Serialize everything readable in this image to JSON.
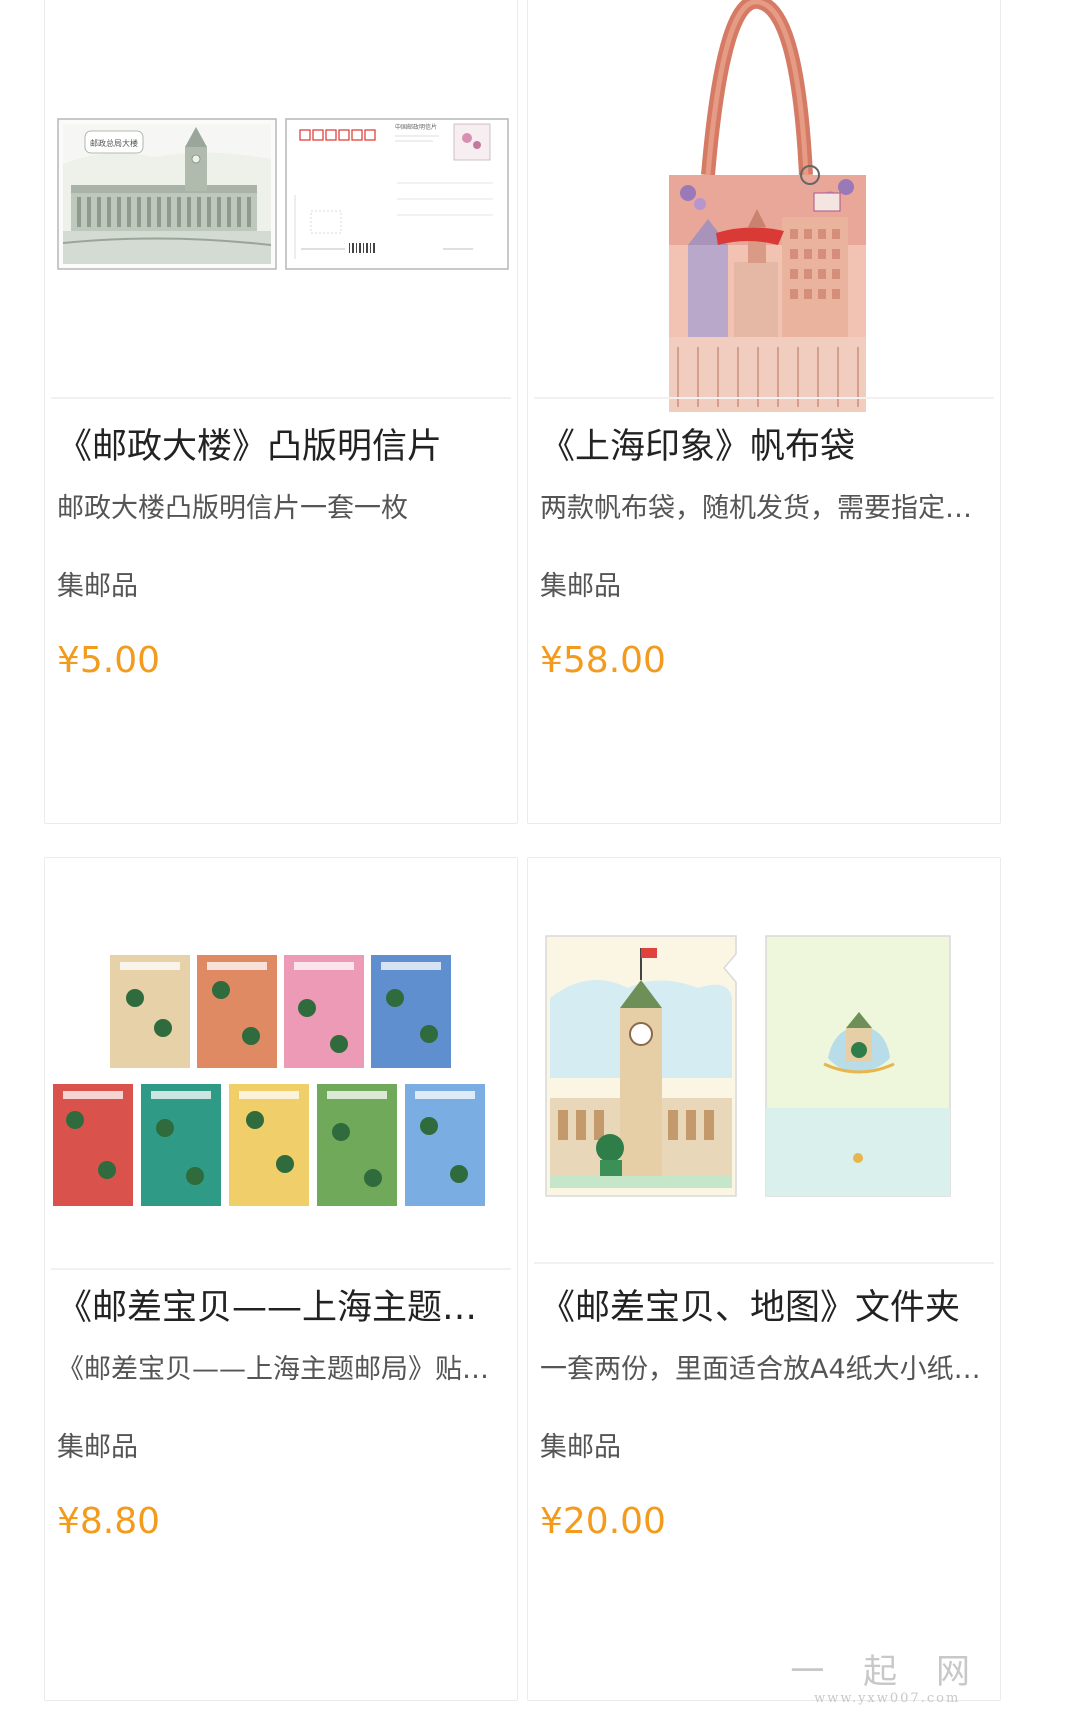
{
  "products": [
    {
      "title": "《邮政大楼》凸版明信片",
      "desc": "邮政大楼凸版明信片一套一枚",
      "category": "集邮品",
      "price": "¥5.00",
      "postcard_front_title": "邮政总局大楼",
      "postcard_back_header": "中国邮政明信片"
    },
    {
      "title": "《上海印象》帆布袋",
      "desc": "两款帆布袋，随机发货，需要指定…",
      "category": "集邮品",
      "price": "¥58.00"
    },
    {
      "title": "《邮差宝贝——上海主题…",
      "desc": "《邮差宝贝——上海主题邮局》贴…",
      "category": "集邮品",
      "price": "¥8.80"
    },
    {
      "title": "《邮差宝贝、地图》文件夹",
      "desc": "一套两份，里面适合放A4纸大小纸…",
      "category": "集邮品",
      "price": "¥20.00"
    }
  ],
  "watermark": {
    "logo": "一 起 网",
    "site": "www.yxw007.com"
  },
  "colors": {
    "price": "#f29b1d",
    "title": "#222222",
    "desc": "#555555",
    "card_border": "#ebebeb"
  }
}
